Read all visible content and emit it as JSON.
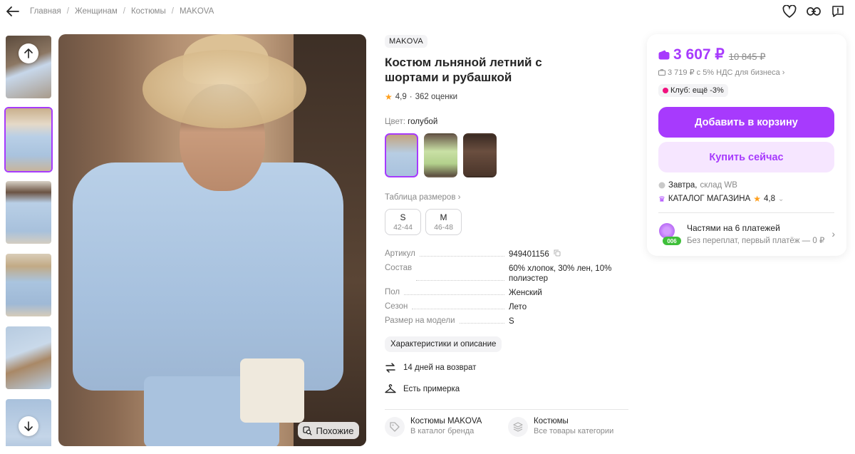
{
  "breadcrumbs": [
    "Главная",
    "Женщинам",
    "Костюмы",
    "MAKOVA"
  ],
  "header_icons": [
    "heart-icon",
    "link-icon",
    "report-icon"
  ],
  "gallery": {
    "similar_label": "Похожие",
    "thumbnail_count": 6,
    "active_index": 1
  },
  "product": {
    "brand": "MAKOVA",
    "title": "Костюм льняной летний с шортами и рубашкой",
    "rating": "4,9",
    "reviews": "362 оценки",
    "color_label": "Цвет:",
    "color_value": "голубой",
    "size_table_label": "Таблица размеров",
    "sizes": [
      {
        "size": "S",
        "range": "42-44"
      },
      {
        "size": "M",
        "range": "46-48"
      }
    ],
    "specs": [
      {
        "key": "Артикул",
        "value": "949401156"
      },
      {
        "key": "Состав",
        "value": "60% хлопок, 30% лен, 10% полиэстер"
      },
      {
        "key": "Пол",
        "value": "Женский"
      },
      {
        "key": "Сезон",
        "value": "Лето"
      },
      {
        "key": "Размер на модели",
        "value": "S"
      }
    ],
    "description_button": "Характеристики и описание",
    "features": [
      {
        "icon": "return-icon",
        "text": "14 дней на возврат"
      },
      {
        "icon": "hanger-icon",
        "text": "Есть примерка"
      }
    ],
    "links": [
      {
        "icon": "tag-icon",
        "title": "Костюмы MAKOVA",
        "subtitle": "В каталог бренда"
      },
      {
        "icon": "stack-icon",
        "title": "Костюмы",
        "subtitle": "Все товары категории"
      }
    ]
  },
  "purchase": {
    "price": "3 607 ₽",
    "old_price": "10 845 ₽",
    "vat_note": "3 719 ₽ с 5% НДС для бизнеса",
    "club": "Клуб: ещё -3%",
    "add_to_cart": "Добавить в корзину",
    "buy_now": "Купить сейчас",
    "delivery_day": "Завтра,",
    "delivery_place": "склад WB",
    "store_name": "КАТАЛОГ МАГАЗИНА",
    "store_rating": "4,8",
    "installments_title": "Частями на 6 платежей",
    "installments_sub": "Без переплат, первый платёж — 0 ₽",
    "installments_badge": "006"
  },
  "colors": {
    "accent": "#a73afd",
    "accent_light": "#f6e6ff",
    "star": "#ff9f1c",
    "text": "#242424",
    "muted": "#8a8a8a"
  }
}
